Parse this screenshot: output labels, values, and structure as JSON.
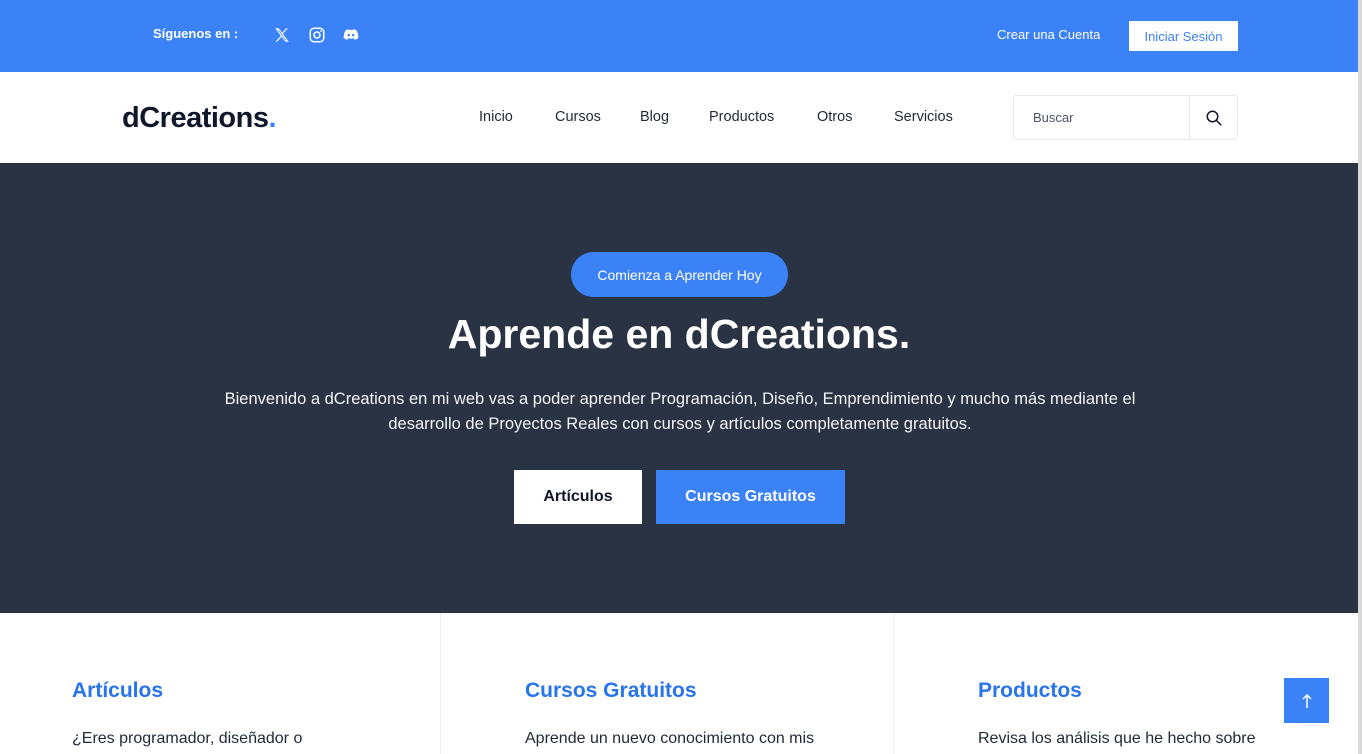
{
  "topbar": {
    "follow_label": "Síguenos en :",
    "social_icons": [
      "x-icon",
      "instagram-icon",
      "discord-icon"
    ],
    "create_account": "Crear una Cuenta",
    "login": "Iniciar Sesión",
    "color": "#3b82f6"
  },
  "navbar": {
    "logo_text": "dCreations",
    "logo_dot": ".",
    "items": [
      {
        "label": "Inicio"
      },
      {
        "label": "Cursos"
      },
      {
        "label": "Blog"
      },
      {
        "label": "Productos"
      },
      {
        "label": "Otros"
      },
      {
        "label": "Servicios"
      }
    ],
    "search_placeholder": "Buscar"
  },
  "hero": {
    "pill_label": "Comienza a Aprender Hoy",
    "title": "Aprende en dCreations.",
    "description": "Bienvenido a dCreations en mi web vas a poder aprender Programación, Diseño, Emprendimiento y mucho más mediante el desarrollo de Proyectos Reales con cursos y artículos completamente gratuitos.",
    "button_primary": "Artículos",
    "button_secondary": "Cursos Gratuitos",
    "background": "#2a3343"
  },
  "features": [
    {
      "title": "Artículos",
      "text": "¿Eres programador, diseñador o"
    },
    {
      "title": "Cursos Gratuitos",
      "text": "Aprende un nuevo conocimiento con mis"
    },
    {
      "title": "Productos",
      "text": "Revisa los análisis que he hecho sobre"
    }
  ],
  "accent": "#3b82f6",
  "back_to_top_icon": "arrow-up-icon"
}
